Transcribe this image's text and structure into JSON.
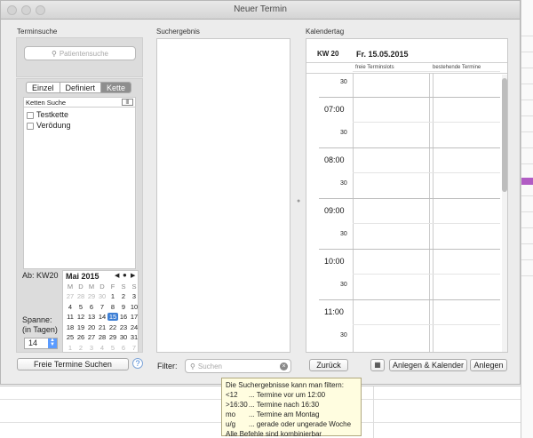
{
  "window": {
    "title": "Neuer Termin"
  },
  "left": {
    "section_title": "Terminsuche",
    "patient_search_placeholder": "Patientensuche",
    "tabs": [
      {
        "label": "Einzel",
        "active": false
      },
      {
        "label": "Definiert",
        "active": false
      },
      {
        "label": "Kette",
        "active": true
      }
    ],
    "chain_search_label": "Ketten Suche",
    "chains": [
      {
        "label": "Testkette",
        "checked": false
      },
      {
        "label": "Verödung",
        "checked": false
      }
    ],
    "ab_label": "Ab: KW20",
    "spanne_label": "Spanne:",
    "spanne_unit": "(in Tagen)",
    "spanne_value": "14",
    "find_button": "Freie Termine Suchen",
    "help": "?"
  },
  "minical": {
    "month_label": "Mai 2015",
    "weekdays": [
      "M",
      "D",
      "M",
      "D",
      "F",
      "S",
      "S"
    ],
    "weeks": [
      [
        "27",
        "28",
        "29",
        "30",
        "1",
        "2",
        "3"
      ],
      [
        "4",
        "5",
        "6",
        "7",
        "8",
        "9",
        "10"
      ],
      [
        "11",
        "12",
        "13",
        "14",
        "15",
        "16",
        "17"
      ],
      [
        "18",
        "19",
        "20",
        "21",
        "22",
        "23",
        "24"
      ],
      [
        "25",
        "26",
        "27",
        "28",
        "29",
        "30",
        "31"
      ],
      [
        "1",
        "2",
        "3",
        "4",
        "5",
        "6",
        "7"
      ]
    ],
    "selected": "15"
  },
  "middle": {
    "section_title": "Suchergebnis",
    "filter_label": "Filter:",
    "filter_placeholder": "Suchen"
  },
  "right": {
    "section_title": "Kalendertag",
    "week_label": "KW 20",
    "date_label": "Fr. 15.05.2015",
    "col_free": "freie Terminslots",
    "col_existing": "bestehende Termine",
    "times": [
      "30",
      "07:00",
      "30",
      "08:00",
      "30",
      "09:00",
      "30",
      "10:00",
      "30",
      "11:00",
      "30"
    ],
    "back_button": "Zurück",
    "create_calendar_button": "Anlegen & Kalender",
    "create_button": "Anlegen"
  },
  "tooltip": {
    "title": "Die Suchergebnisse kann man filtern:",
    "rows": [
      {
        "k": "<12",
        "v": "... Termine vor um 12:00"
      },
      {
        "k": ">16:30",
        "v": "... Termine nach 16:30"
      },
      {
        "k": "mo",
        "v": "... Termine am Montag"
      },
      {
        "k": "u/g",
        "v": "... gerade oder ungerade Woche"
      }
    ],
    "footer": "Alle Befehle sind kombinierbar"
  }
}
